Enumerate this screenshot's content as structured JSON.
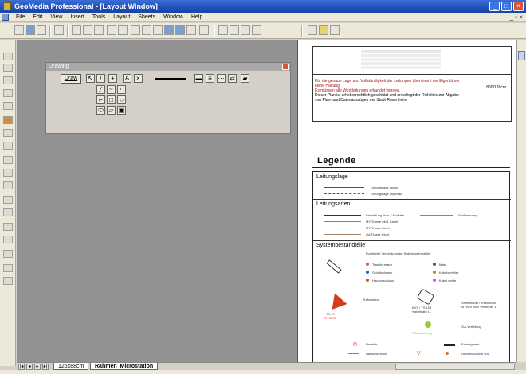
{
  "window": {
    "title": "GeoMedia Professional - [Layout Window]",
    "minimize": "_",
    "maximize": "□",
    "close": "×",
    "mdi_controls": "_ ▫ ×"
  },
  "menu": {
    "items": [
      "File",
      "Edit",
      "View",
      "Insert",
      "Tools",
      "Layout",
      "Sheets",
      "Window",
      "Help"
    ]
  },
  "drawing_toolbar": {
    "title": "Drawing",
    "draw_button": "Draw",
    "text_tool": "A",
    "delete_tool": "×"
  },
  "sheet": {
    "notice_line1": "Für die genaue Lage und Vollständigkeit der Leitungen übernimmt der Eigentümer keine Haftung.",
    "notice_line2": "Es müssen alle Werkleitungen erkundet werden.",
    "notice_line3": "Dieser Plan ist urheberrechtlich geschützt und unterliegt der Richtlinie zur Abgabe",
    "notice_line4": "von Plan- und Datenauszügen der Stadt Rosenheim",
    "scale": "850/126cm",
    "legend_title": "Legende",
    "sections": {
      "leitungslage": "Leitungslage",
      "leitungsarten": "Leitungsarten",
      "systembestandteile": "Systembestandteile"
    },
    "leitungslage_items": [
      "Leitungslage genau",
      "Leitungslage ungenau"
    ],
    "leitungsarten_items": [
      "Fernleitung über 2 Punkten",
      "MV Trasse mit 1 Kabel",
      "MV Trasse leicht",
      "GA Trasse leicht",
      "Stoßtrennung"
    ],
    "system_sub": "Punktliche Verbindung der Kabelsystemstelle",
    "system_items": [
      "Transformator",
      "Mast",
      "Schaltschrank",
      "Kabelverteiler",
      "Hausanschluss",
      "Kabel muffe"
    ],
    "station_label": "Trafostation",
    "station_red": "TS 95\nGYM 53",
    "kvs_label": "KVS / TS 103\nKabeltrafo 11",
    "kvs_desc": "Verteilkabel / Trenndose\nin Rohr oder Verbindet 1",
    "ga_label": "GA-Verteilung",
    "ga_green": "GA-Verteilung",
    "rows": [
      [
        "Verteiler I",
        "Endsegment"
      ],
      [
        "Hausanschluss",
        "Hausanschluss GA"
      ],
      [
        "Muffe MS",
        "Endmuffe MS"
      ],
      [
        "Muffe NS",
        "Endmuffe NS"
      ]
    ]
  },
  "tabs": {
    "first": "126x88cm",
    "second": "Rahmen_Microstation"
  },
  "colors": {
    "title_bar": "#1f4fb8",
    "accent_red": "#d83a1e",
    "legend_pink": "#e0607a",
    "legend_orange": "#e89030",
    "legend_green": "#9ccc30"
  }
}
